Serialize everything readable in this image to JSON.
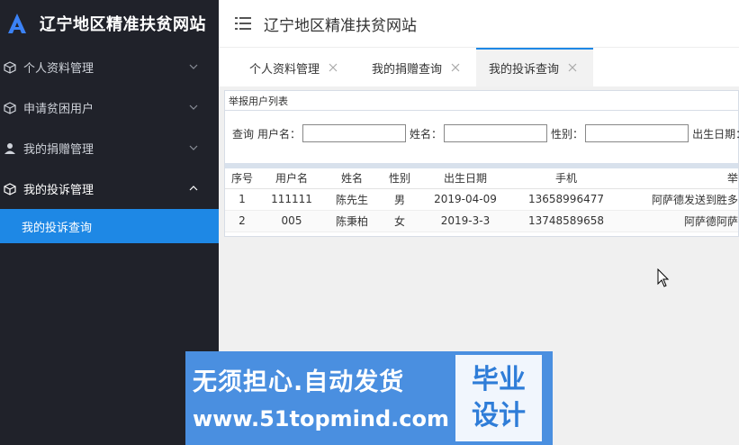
{
  "app": {
    "title": "辽宁地区精准扶贫网站"
  },
  "sidebar": {
    "items": [
      {
        "label": "个人资料管理",
        "icon": "cube-icon"
      },
      {
        "label": "申请贫困用户",
        "icon": "cube-icon"
      },
      {
        "label": "我的捐赠管理",
        "icon": "user-icon"
      },
      {
        "label": "我的投诉管理",
        "icon": "cube-icon"
      }
    ],
    "subitem": {
      "label": "我的投诉查询"
    }
  },
  "header": {
    "title": "辽宁地区精准扶贫网站"
  },
  "tabs": [
    {
      "label": "个人资料管理"
    },
    {
      "label": "我的捐赠查询"
    },
    {
      "label": "我的投诉查询"
    }
  ],
  "panel": {
    "title": "举报用户列表",
    "search": {
      "query_label": "查询",
      "username_label": "用户名：",
      "name_label": "姓名：",
      "gender_label": "性别：",
      "birth_label": "出生日期："
    }
  },
  "table": {
    "headers": [
      "序号",
      "用户名",
      "姓名",
      "性别",
      "出生日期",
      "手机",
      "举"
    ],
    "rows": [
      [
        "1",
        "111111",
        "陈先生",
        "男",
        "2019-04-09",
        "13658996477",
        "阿萨德发送到胜多"
      ],
      [
        "2",
        "005",
        "陈秉柏",
        "女",
        "2019-3-3",
        "13748589658",
        "阿萨德阿萨"
      ]
    ]
  },
  "watermark": {
    "line1": "无须担心.自动发货",
    "line2": "www.51topmind.com",
    "badge_top": "毕业",
    "badge_bottom": "设计"
  },
  "colors": {
    "sidebar": "#20222a",
    "accent": "#1e88e5",
    "watermark": "#4a8fe0"
  }
}
